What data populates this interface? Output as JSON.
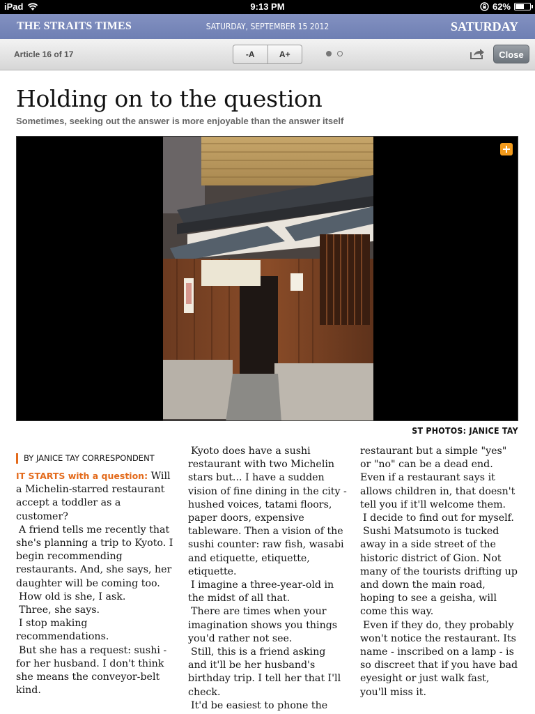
{
  "status_bar": {
    "device": "iPad",
    "time": "9:13 PM",
    "battery": "62%",
    "battery_level": 0.62
  },
  "masthead": {
    "logo": "THE STRAITS TIMES",
    "date": "SATURDAY, SEPTEMBER 15 2012",
    "day": "SATURDAY"
  },
  "toolbar": {
    "article_counter": "Article 16 of 17",
    "font_decrease": "-A",
    "font_increase": "A+",
    "close_label": "Close",
    "page_indicator": {
      "current": 1,
      "total": 2
    }
  },
  "article": {
    "headline": "Holding on to the question",
    "deck": "Sometimes, seeking out the answer is more enjoyable than the answer itself",
    "photo_credit": "ST PHOTOS: JANICE TAY",
    "byline": "BY JANICE TAY CORRESPONDENT",
    "lead_in": "IT STARTS with a question:",
    "col1_after_lead": " Will a Michelin-starred restaurant accept a toddler as a customer?",
    "col1_paragraphs": [
      "A friend tells me recently that she's planning a trip to Kyoto. I begin recommending restaurants. And, she says, her daughter will be coming too.",
      "How old is she, I ask.",
      "Three, she says.",
      "I stop making recommendations.",
      "But she has a request: sushi - for her husband. I don't think she means the conveyor-belt kind."
    ],
    "col2_paragraphs": [
      "Kyoto does have a sushi restaurant with two Michelin stars but... I have a sudden vision of fine dining in the city - hushed voices, tatami floors, paper doors, expensive tableware. Then a vision of the sushi counter: raw fish, wasabi and etiquette, etiquette, etiquette.",
      "I imagine a three-year-old in the midst of all that.",
      "There are times when your imagination shows you things you'd rather not see.",
      "Still, this is a friend asking and it'll be her husband's birthday trip. I tell her that I'll check.",
      "It'd be easiest to phone the"
    ],
    "col3_first": "restaurant but a simple \"yes\" or \"no\" can be a dead end. Even if a restaurant says it allows children in, that doesn't tell you if it'll welcome them.",
    "col3_paragraphs": [
      "I decide to find out for myself.",
      "Sushi Matsumoto is tucked away in a side street of the historic district of Gion. Not many of the tourists drifting up and down the main road, hoping to see a geisha, will come this way.",
      "Even if they do, they probably won't notice the restaurant. Its name - inscribed on a lamp - is so discreet that if you have bad eyesight or just walk fast, you'll miss it."
    ]
  },
  "icons": {
    "wifi": "wifi-icon",
    "lock": "orientation-lock-icon",
    "battery": "battery-icon",
    "share": "share-icon",
    "expand": "expand-photo-icon"
  },
  "colors": {
    "masthead": "#7585b8",
    "accent": "#e36a1b",
    "expand_button": "#f39b1c"
  }
}
